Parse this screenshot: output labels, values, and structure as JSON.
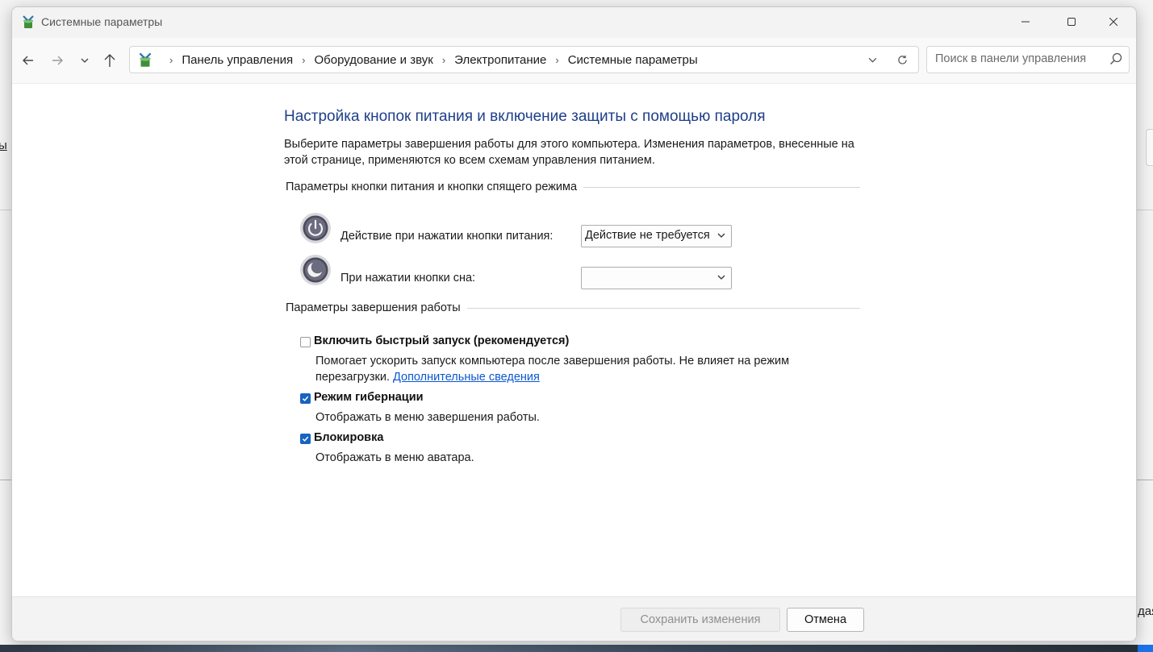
{
  "background": {
    "left_text": "ы",
    "right_text": "дая"
  },
  "window": {
    "title": "Системные параметры",
    "controls": {
      "minimize": "minimize-icon",
      "maximize": "maximize-icon",
      "close": "close-icon"
    }
  },
  "nav": {
    "breadcrumbs": [
      "Панель управления",
      "Оборудование и звук",
      "Электропитание",
      "Системные параметры"
    ],
    "search_placeholder": "Поиск в панели управления"
  },
  "main": {
    "heading": "Настройка кнопок питания и включение защиты с помощью пароля",
    "description": "Выберите параметры завершения работы для этого компьютера. Изменения параметров, внесенные на этой странице, применяются ко всем схемам управления питанием.",
    "group_buttons": "Параметры кнопки питания и кнопки спящего режима",
    "power_button_label": "Действие при нажатии кнопки питания:",
    "power_button_value": "Действие не требуется",
    "sleep_button_label": "При нажатии кнопки сна:",
    "sleep_button_value": "",
    "group_shutdown": "Параметры завершения работы",
    "fast_startup": {
      "checked": false,
      "title": "Включить быстрый запуск (рекомендуется)",
      "desc": "Помогает ускорить запуск компьютера после завершения работы. Не влияет на режим перезагрузки.",
      "link": "Дополнительные сведения"
    },
    "hibernate": {
      "checked": true,
      "title": "Режим гибернации",
      "desc": "Отображать в меню завершения работы."
    },
    "lock": {
      "checked": true,
      "title": "Блокировка",
      "desc": "Отображать в меню аватара."
    }
  },
  "footer": {
    "save_label": "Сохранить изменения",
    "cancel_label": "Отмена"
  },
  "colors": {
    "heading": "#1e3f8a",
    "checkbox_checked": "#1664c0",
    "link": "#0b57d0"
  }
}
